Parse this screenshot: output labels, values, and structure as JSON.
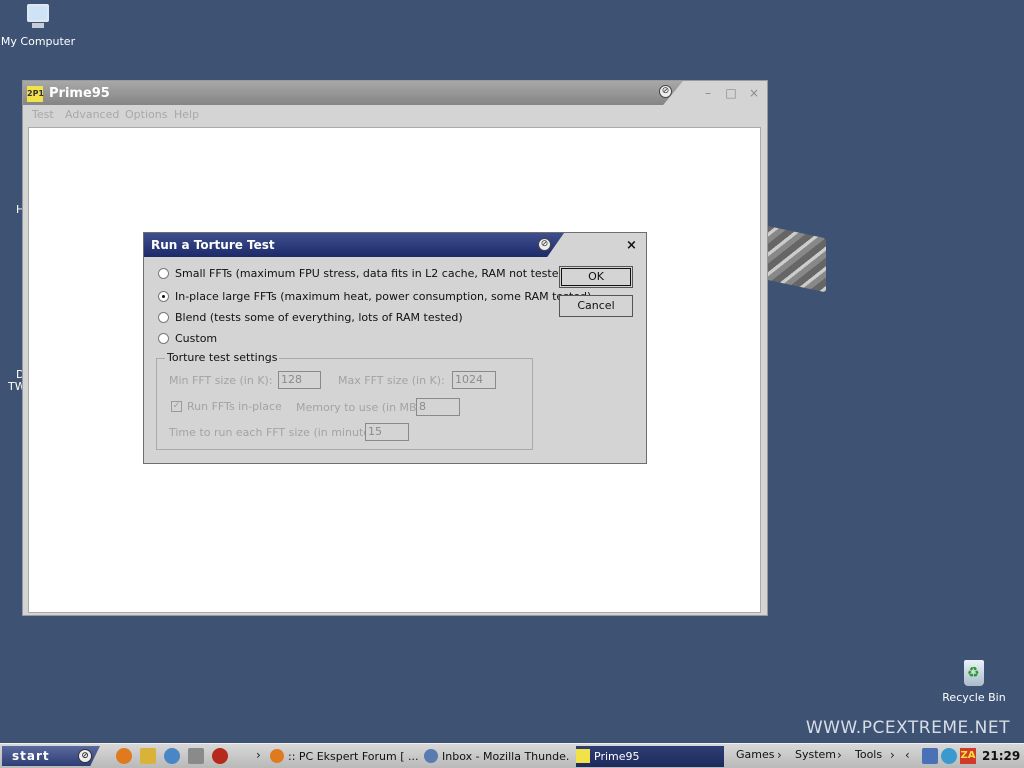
{
  "desktop": {
    "icons": {
      "my_computer": "My Computer",
      "recycle_bin": "Recycle Bin"
    },
    "partial_labels": [
      "H",
      "D",
      "TW"
    ],
    "watermark": "WWW.PCEXTREME.NET"
  },
  "main_window": {
    "title": "Prime95",
    "logo_text": "2P1",
    "menu": [
      "Test",
      "Advanced",
      "Options",
      "Help"
    ],
    "controls": {
      "minimize": "–",
      "maximize": "□",
      "close": "×"
    }
  },
  "dialog": {
    "title": "Run a Torture Test",
    "close": "×",
    "options": [
      {
        "label": "Small FFTs (maximum FPU stress, data fits in L2 cache, RAM not tested much)",
        "checked": false
      },
      {
        "label": "In-place large FFTs (maximum heat, power consumption, some RAM tested)",
        "checked": true
      },
      {
        "label": "Blend (tests some of everything, lots of RAM tested)",
        "checked": false
      },
      {
        "label": "Custom",
        "checked": false
      }
    ],
    "buttons": {
      "ok": "OK",
      "cancel": "Cancel"
    },
    "settings": {
      "legend": "Torture test settings",
      "min_fft_label": "Min FFT size (in K):",
      "min_fft_value": "128",
      "max_fft_label": "Max FFT size (in K):",
      "max_fft_value": "1024",
      "run_inplace_label": "Run FFTs in-place",
      "run_inplace_checked": true,
      "memory_label": "Memory to use (in MB):",
      "memory_value": "8",
      "time_label": "Time to run each FFT size (in minutes):",
      "time_value": "15"
    }
  },
  "taskbar": {
    "start_label": "start",
    "tasks": [
      {
        "label": ":: PC Ekspert Forum [ ...",
        "active": false
      },
      {
        "label": "Inbox - Mozilla Thunde...",
        "active": false
      },
      {
        "label": "Prime95",
        "active": true
      }
    ],
    "menus": [
      "Games",
      "System",
      "Tools"
    ],
    "clock": "21:29"
  },
  "colors": {
    "desktop": "#3e5273",
    "dialog_title": "#2a3a7c",
    "active_task": "#2e3d73"
  }
}
